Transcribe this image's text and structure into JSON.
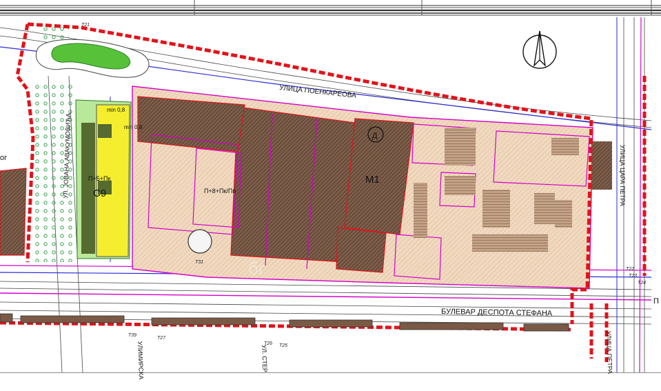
{
  "header": {
    "frame_color": "#555555"
  },
  "map": {
    "background": "#ffffff",
    "colors": {
      "plot_boundary": "#e0141b",
      "building_fill": "#7a5a45",
      "development_fill": "#f0d9bf",
      "parking_fill": "#b59277",
      "green_fill": "#57c13a",
      "yellow_zone": "#f5ee2e",
      "magenta_line": "#d400c8",
      "blue_line": "#2a2ad6",
      "road_line": "#333333",
      "vegetation": "#2f9e45"
    },
    "labels": {
      "street_north": "УЛИЦА ПОЕНКАРЕОВА",
      "boulevard": "БУЛЕВАР ДЕСПОТА СТЕФАНА",
      "street_west": "УЛ. ЈОВАНА АВАКУМОВИЋА",
      "street_south_1": "УЛИМИРСКА",
      "street_south_2": "УЛ. СТЕР",
      "street_east": "УЛИЦА ЦАРА ПЕТРА",
      "street_south_east": "УЛИЦА ПЕТРА",
      "plot_m1": "M1",
      "plot_c9": "C9",
      "zone_d": "Д",
      "floors_main": "П+8+Пк/Пп",
      "floors_c9": "П+5+Пк",
      "min_top": "min 0,8",
      "min_mid": "min 0,8",
      "edge_p": "П",
      "edge_g": "ог",
      "t27": "T27",
      "t39": "T39",
      "t26": "T26",
      "t25": "T25",
      "t24": "T24",
      "t22": "T22",
      "t23": "T23",
      "t21": "T21",
      "t31": "T31",
      "watermark": "бг"
    },
    "compass": {
      "icon": "north-arrow-icon"
    }
  }
}
